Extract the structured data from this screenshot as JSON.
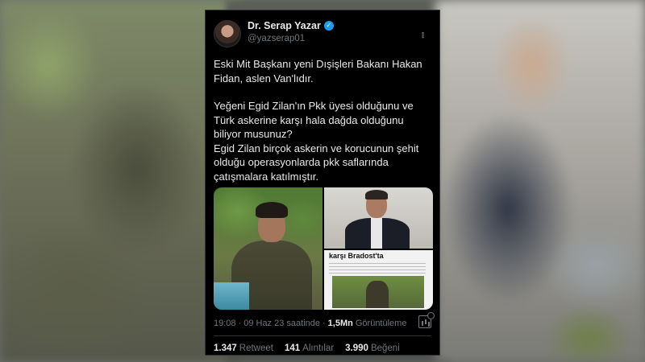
{
  "tweet": {
    "author": {
      "display_name": "Dr. Serap Yazar",
      "handle": "@yazserap01",
      "verified": true
    },
    "paragraphs": [
      "Eski Mit Başkanı yeni Dışişleri Bakanı Hakan Fidan, aslen Van'lıdır.",
      "Yeğeni Egid Zilan'ın Pkk üyesi olduğunu ve Türk askerine karşı hala dağda olduğunu biliyor musunuz?",
      "Egid Zilan birçok askerin ve korucunun şehit olduğu operasyonlarda pkk saflarında çatışmalara katılmıştır."
    ],
    "media": {
      "headline": "karşı Bradost'ta"
    },
    "meta": {
      "time": "19:08",
      "date": "09 Haz 23 saatinde",
      "views_count": "1,5Mn",
      "views_label": "Görüntüleme"
    },
    "stats": {
      "retweets_count": "1.347",
      "retweets_label": "Retweet",
      "quotes_count": "141",
      "quotes_label": "Alıntılar",
      "likes_count": "3.990",
      "likes_label": "Beğeni"
    },
    "icons": {
      "verified": "verified-badge-icon",
      "more": "more-options-icon",
      "analytics": "analytics-icon"
    },
    "colors": {
      "background": "#000000",
      "text": "#e7e9ea",
      "muted": "#71767b",
      "verified": "#1d9bf0"
    }
  }
}
